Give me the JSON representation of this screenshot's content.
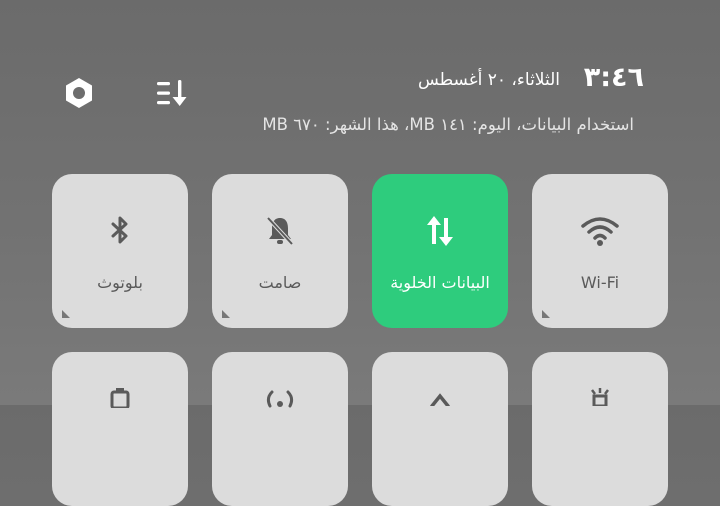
{
  "header": {
    "clock": "٣:٤٦",
    "date": "الثلاثاء، ٢٠ أغسطس",
    "data_usage": "استخدام البيانات، اليوم: ١٤١ MB، هذا الشهر: ٦٧٠ MB",
    "settings_icon": "gear-icon",
    "edit_icon": "sort-edit-icon"
  },
  "tiles": [
    {
      "label": "Wi-Fi",
      "icon": "wifi-icon",
      "active": false
    },
    {
      "label": "البيانات الخلوية",
      "icon": "mobile-data-icon",
      "active": true
    },
    {
      "label": "صامت",
      "icon": "bell-off-icon",
      "active": false
    },
    {
      "label": "بلوتوث",
      "icon": "bluetooth-icon",
      "active": false
    }
  ],
  "colors": {
    "background": "#727272",
    "tile": "#dcdcdc",
    "active_tile": "#2ecc7d",
    "tile_icon": "#5a5a5a"
  }
}
